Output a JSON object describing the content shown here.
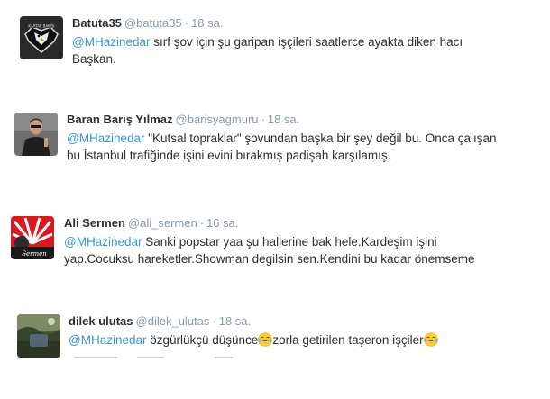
{
  "tweets": [
    {
      "name": "Batuta35",
      "handle": "@batuta35",
      "separator": "·",
      "time": "18 sa.",
      "mention": "@MHazinedar",
      "line1_rest": " sırf şov için şu garipan işçileri saatlerce ayakta diken hacı",
      "line2": "Başkan.",
      "avatar_text": "KARTAL BAKIŞI"
    },
    {
      "name": "Baran Barış Yılmaz",
      "handle": "@barisyagmuru",
      "separator": "·",
      "time": "18 sa.",
      "mention": "@MHazinedar",
      "line1_rest": " \"Kutsal topraklar\" şovundan başka bir şey değil bu. Onca çalışan",
      "line2": "bu İstanbul trafiğinde işini evini bırakmış padişah karşılamış."
    },
    {
      "name": "Ali Sermen",
      "handle": "@ali_sermen",
      "separator": "·",
      "time": "16 sa.",
      "mention": "@MHazinedar",
      "line1_rest": " Sanki popstar yaa şu hallerine bak hele.Kardeşim işini",
      "line2": "yap.Cocuksu hareketler.Showman degilsin sen.Kendini bu kadar önemseme",
      "avatar_text": "Sermen"
    },
    {
      "name": "dilek ulutas",
      "handle": "@dilek_ulutas",
      "separator": "·",
      "time": "18 sa.",
      "mention": "@MHazinedar",
      "text_a": " özgürlükçü düşünce",
      "text_b": "zorla getirilen taşeron işçiler",
      "emoji": "face-with-tears-of-joy"
    }
  ],
  "colors": {
    "name": "#292f33",
    "meta": "#8899a6",
    "mention": "#3b94d9"
  }
}
